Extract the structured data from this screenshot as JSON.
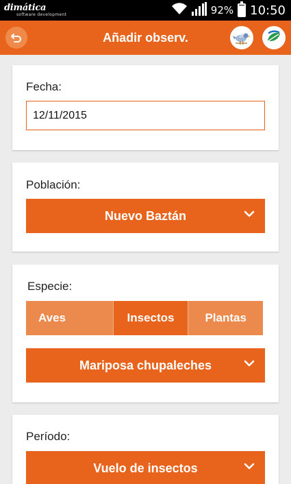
{
  "status_bar": {
    "brand": "dimática",
    "brand_sub": "software development",
    "battery": "92%",
    "battery_level": 0.92,
    "time": "10:50"
  },
  "action_bar": {
    "title": "Añadir observ."
  },
  "fecha": {
    "label": "Fecha:",
    "value": "12/11/2015"
  },
  "poblacion": {
    "label": "Población:",
    "selected": "Nuevo Baztán"
  },
  "especie": {
    "label": "Especie:",
    "tabs": [
      "Aves",
      "Insectos",
      "Plantas"
    ],
    "active_tab": "Insectos",
    "selected": "Mariposa chupaleches"
  },
  "periodo": {
    "label": "Período:",
    "selected": "Vuelo de insectos"
  },
  "colors": {
    "accent": "#e8641c",
    "accent_light": "#ec8a4e",
    "background": "#ececec"
  }
}
